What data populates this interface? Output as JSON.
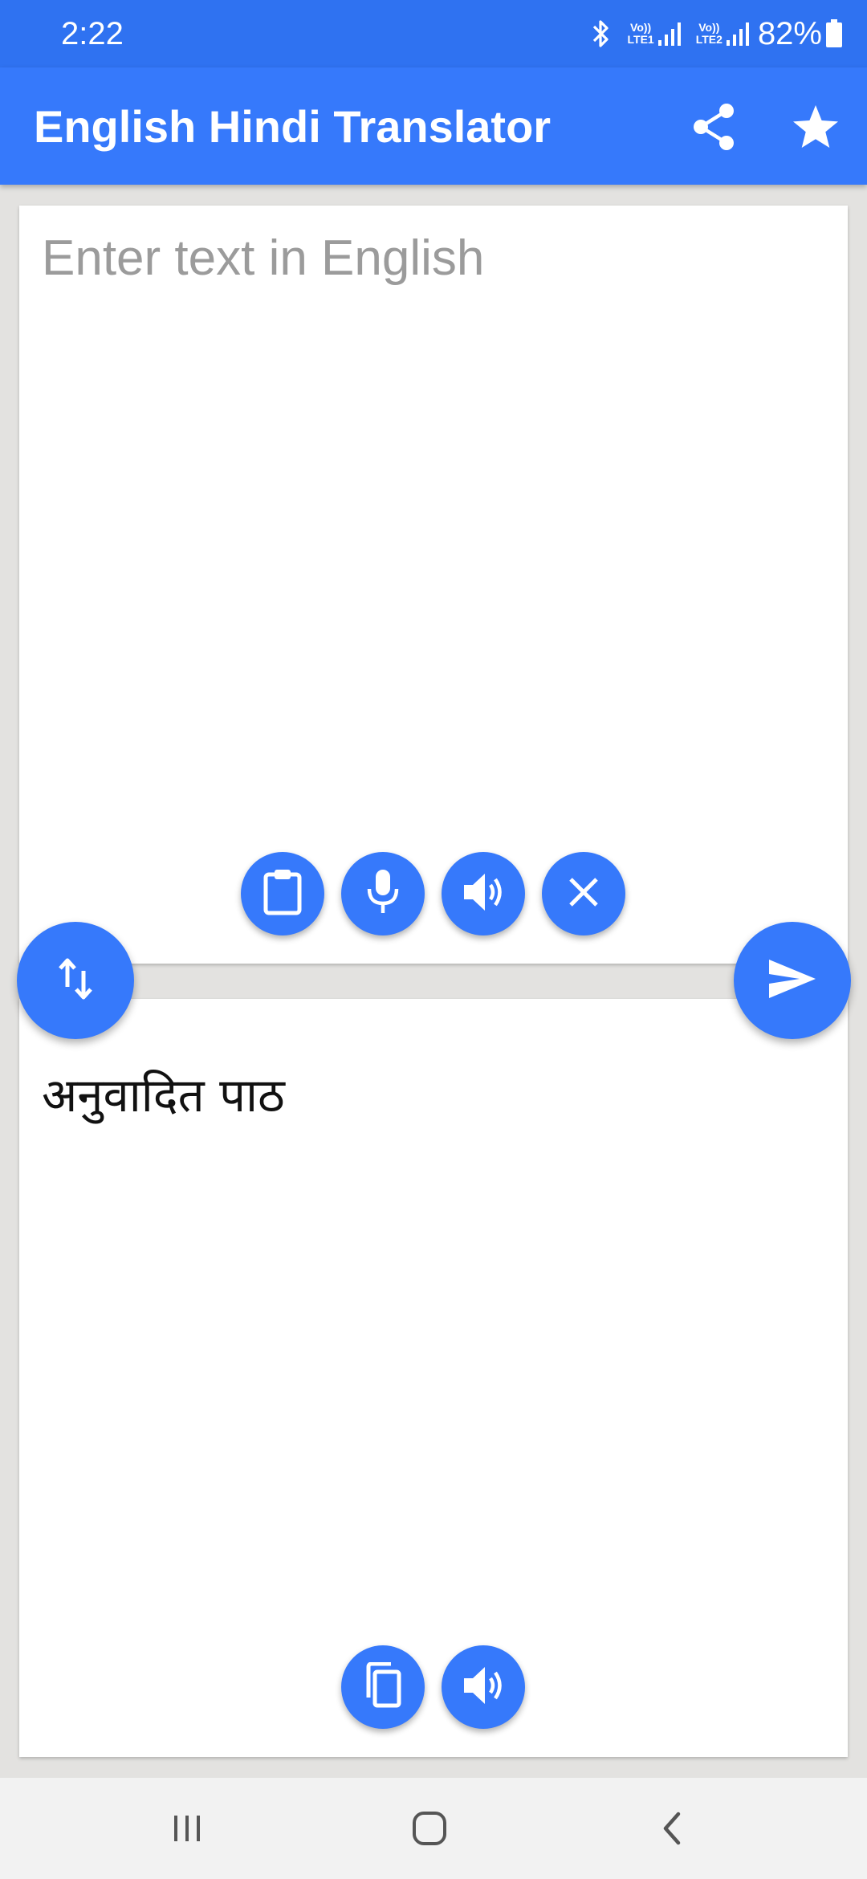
{
  "status_bar": {
    "time": "2:22",
    "sim1_top": "Vo))",
    "sim1_bottom": "LTE1",
    "sim2_top": "Vo))",
    "sim2_bottom": "LTE2",
    "battery": "82%"
  },
  "app_bar": {
    "title": "English Hindi Translator",
    "icons": [
      "share-icon",
      "star-icon"
    ]
  },
  "input": {
    "value": "",
    "placeholder": "Enter text in English"
  },
  "input_actions": [
    "clipboard-icon",
    "microphone-icon",
    "speaker-icon",
    "close-icon"
  ],
  "swap_button": {
    "icon": "swap-vertical-icon"
  },
  "translate_button": {
    "icon": "send-icon"
  },
  "output": {
    "text": "अनुवादित पाठ"
  },
  "output_actions": [
    "copy-icon",
    "speaker-icon"
  ],
  "nav_bar": [
    "recent-apps-icon",
    "home-icon",
    "back-icon"
  ],
  "colors": {
    "status_bar": "#2f72f1",
    "app_bar": "#3679fb",
    "accent": "#3679fb",
    "background": "#e3e2e0",
    "card": "#ffffff",
    "placeholder": "#9b9b9b",
    "nav_bar": "#f2f2f2"
  }
}
